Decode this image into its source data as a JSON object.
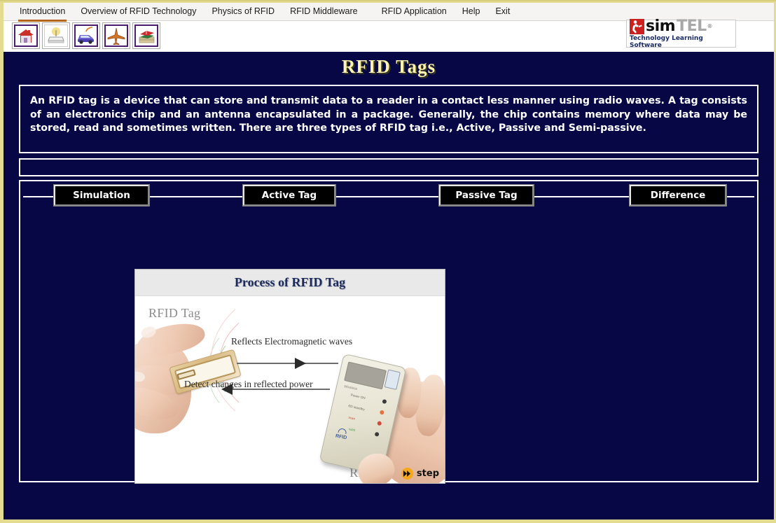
{
  "window": {
    "title": "RFID Tags",
    "frame_color": "#e3db8f",
    "stage_color": "#070745"
  },
  "menubar": {
    "items": [
      {
        "label": "Introduction",
        "active": true
      },
      {
        "label": "Overview of RFID Technology",
        "active": false
      },
      {
        "label": "Physics of RFID",
        "active": false
      },
      {
        "label": "RFID Middleware",
        "active": false
      },
      {
        "label": "RFID Application",
        "active": false
      },
      {
        "label": "Help",
        "active": false
      },
      {
        "label": "Exit",
        "active": false
      }
    ],
    "active_underline_color": "#b5651d"
  },
  "toolbar": {
    "buttons": [
      {
        "icon": "house-icon",
        "name": "home-tool"
      },
      {
        "icon": "router-icon",
        "name": "router-tool"
      },
      {
        "icon": "car-wireless-icon",
        "name": "vehicle-tool"
      },
      {
        "icon": "airplane-icon",
        "name": "aviation-tool"
      },
      {
        "icon": "books-icon",
        "name": "library-tool"
      }
    ]
  },
  "logo": {
    "mark": "running-person-icon",
    "text_primary": "sim",
    "text_secondary": "TEL",
    "registered": "®",
    "tagline": "Technology Learning  Software",
    "mark_color": "#cc1f1f",
    "tagline_color": "#1a2a63"
  },
  "header": {
    "title": "RFID Tags",
    "title_color": "#fdf3ae"
  },
  "description": {
    "text": "An RFID tag is a device that can store and transmit data to a reader in a contact less manner using radio waves. A tag consists of an electronics chip and an antenna encapsulated in a package. Generally, the chip contains memory where data may be stored, read and sometimes written. There are three types of RFID tag i.e., Active, Passive and Semi-passive."
  },
  "tabs": [
    {
      "label": "Simulation",
      "selected": true
    },
    {
      "label": "Active Tag",
      "selected": false
    },
    {
      "label": "Passive Tag",
      "selected": false
    },
    {
      "label": "Difference",
      "selected": false
    }
  ],
  "content_card": {
    "title": "Process of RFID Tag",
    "tag_label": "RFID Tag",
    "reader_label": "RFID Reader",
    "arrow_forward_label": "Reflects Electromagnetic waves",
    "arrow_reverse_label": "Detect changes in reflected power",
    "reader_device": {
      "brand_text": "RFID Reader",
      "model_text": "Wireless",
      "led_labels": [
        "Power ON",
        "RD standby",
        "scan",
        "valid"
      ],
      "logo_text": "RFID"
    },
    "step_button": {
      "label": "step",
      "icon": "fast-forward-icon",
      "color": "#f5a81c"
    }
  }
}
